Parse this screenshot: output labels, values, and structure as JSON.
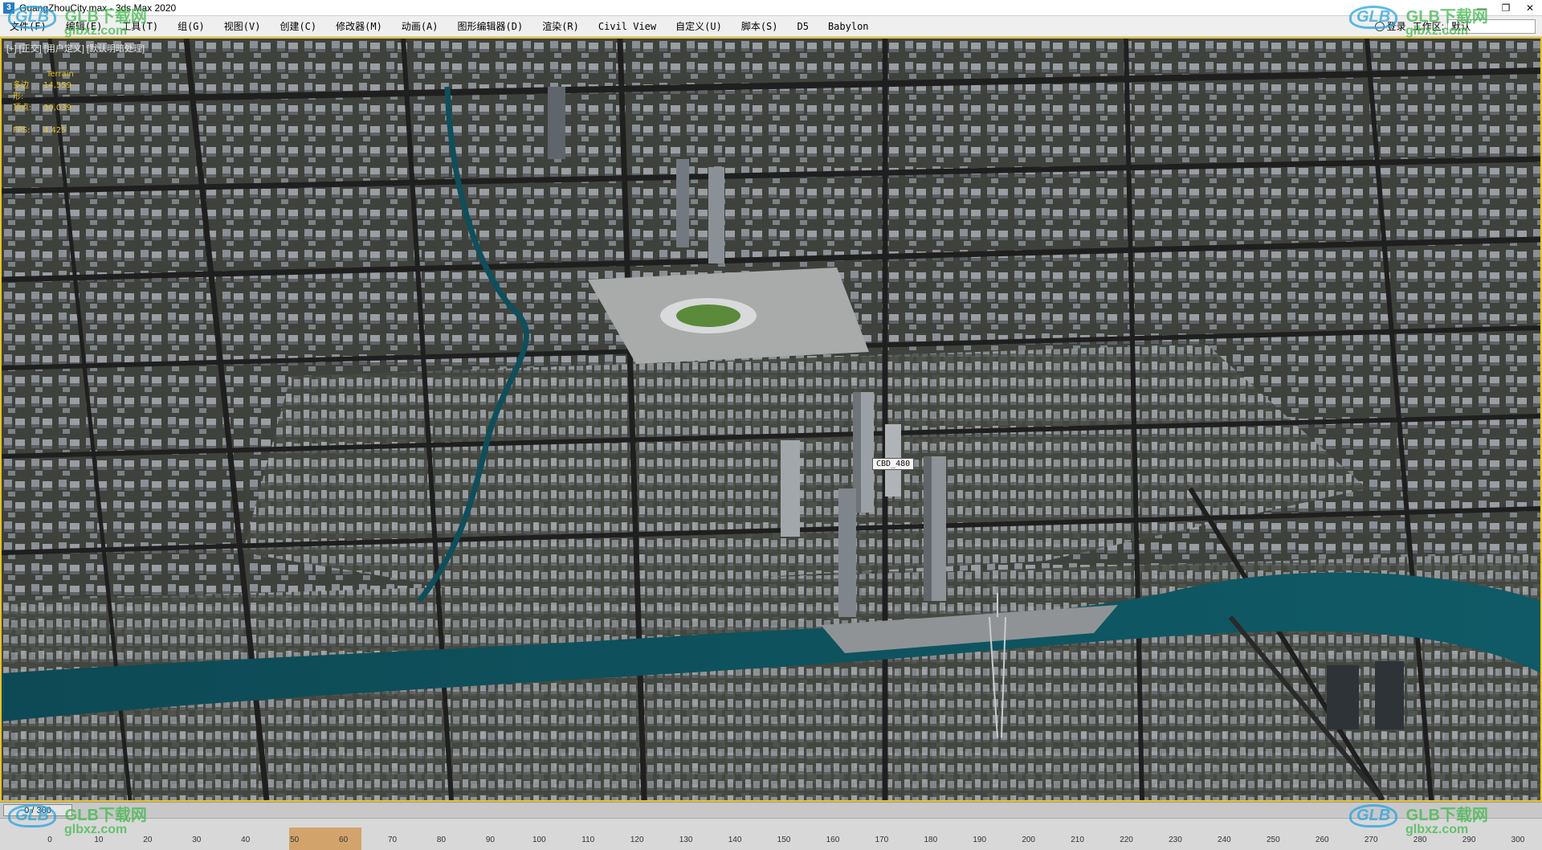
{
  "window": {
    "title": "GuangZhouCity.max - 3ds Max 2020",
    "app_icon": "3",
    "minimize": "—",
    "maximize": "❐",
    "close": "✕"
  },
  "menu": {
    "items": [
      "文件(F)",
      "编辑(E)",
      "工具(T)",
      "组(G)",
      "视图(V)",
      "创建(C)",
      "修改器(M)",
      "动画(A)",
      "图形编辑器(D)",
      "渲染(R)",
      "Civil View",
      "自定义(U)",
      "脚本(S)",
      "D5",
      "Babylon"
    ],
    "login": "登录",
    "workspace_label": "工作区:",
    "workspace_value": "默认"
  },
  "viewport": {
    "label": "[+] [正交] [用户定义] [默认明暗处理]",
    "stats": {
      "object": "Terrain",
      "poly_label": "多边形:",
      "poly_value": "14,559",
      "vert_label": "顶点:",
      "vert_value": "30,039",
      "fps_label": "FPS:",
      "fps_value": "4.425"
    },
    "object_label": "CBD_480"
  },
  "timeline": {
    "current": "0 / 300",
    "ticks": [
      "0",
      "10",
      "20",
      "30",
      "40",
      "50",
      "60",
      "70",
      "80",
      "90",
      "100",
      "110",
      "120",
      "130",
      "140",
      "150",
      "160",
      "170",
      "180",
      "190",
      "200",
      "210",
      "220",
      "230",
      "240",
      "250",
      "260",
      "270",
      "280",
      "290",
      "300"
    ]
  },
  "watermark": {
    "logo": "GLB",
    "cn": "GLB下载网",
    "url": "glbxz.com"
  },
  "colors": {
    "viewport_border": "#e6c229",
    "river": "#0f4e5a",
    "ground": "#3a3d37",
    "road": "#232323",
    "building": "#7a7f86"
  }
}
